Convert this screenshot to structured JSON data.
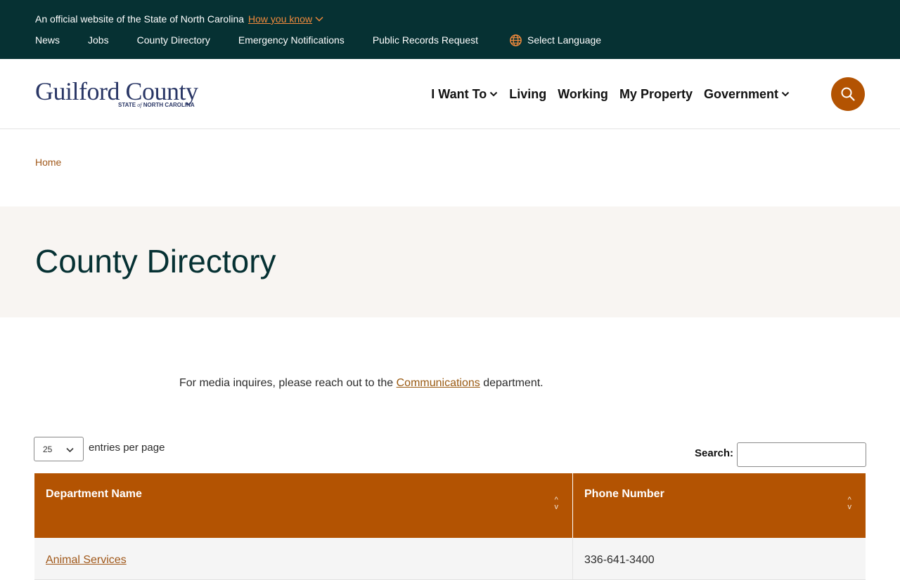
{
  "banner": {
    "official_text": "An official website of the State of North Carolina",
    "how_you_know": "How you know",
    "links": [
      "News",
      "Jobs",
      "County Directory",
      "Emergency Notifications",
      "Public Records Request"
    ],
    "language_label": "Select Language"
  },
  "header": {
    "logo_main": "Guilford County",
    "logo_sub_1": "STATE",
    "logo_sub_of": "of",
    "logo_sub_2": "NORTH CAROLINA",
    "nav": [
      {
        "label": "I Want To",
        "dropdown": true
      },
      {
        "label": "Living",
        "dropdown": false
      },
      {
        "label": "Working",
        "dropdown": false
      },
      {
        "label": "My Property",
        "dropdown": false
      },
      {
        "label": "Government",
        "dropdown": true
      }
    ],
    "search_icon": "search-icon"
  },
  "breadcrumb": {
    "home": "Home"
  },
  "page": {
    "title": "County Directory"
  },
  "intro": {
    "before": "For media inquires, please reach out to the ",
    "link": "Communications",
    "after": " department."
  },
  "table_controls": {
    "per_page_value": "25",
    "per_page_label": "entries per page",
    "search_label": "Search:",
    "search_value": ""
  },
  "table": {
    "columns": [
      "Department Name",
      "Phone Number"
    ],
    "rows": [
      {
        "department": "Animal Services",
        "phone": "336-641-3400"
      }
    ]
  },
  "colors": {
    "banner_bg": "#063133",
    "accent": "#b35302",
    "link": "#a0581a",
    "title_band_bg": "#f8f5f2"
  }
}
